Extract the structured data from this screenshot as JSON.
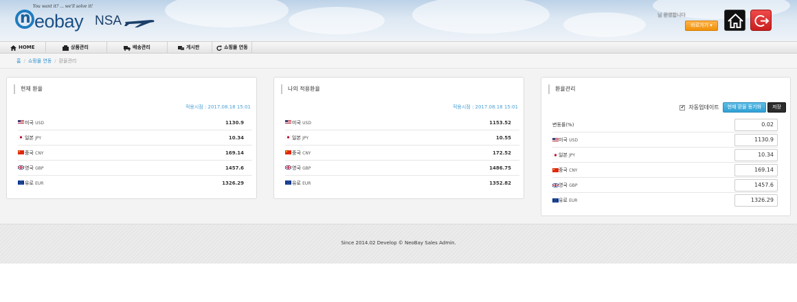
{
  "header": {
    "logo_tagline": "You want it? ... we'll solve it!",
    "logo_name": "eobay",
    "logo_suffix": "NSA",
    "user_info": "님 환영합니다",
    "dropdown_label": "바로가기 ▾"
  },
  "nav": {
    "items": [
      {
        "label": "HOME",
        "icon": "home-icon"
      },
      {
        "label": "상품관리",
        "icon": "box-icon"
      },
      {
        "label": "배송관리",
        "icon": "truck-icon"
      },
      {
        "label": "게시판",
        "icon": "board-icon"
      },
      {
        "label": "쇼핑몰 연동",
        "icon": "refresh-icon"
      }
    ]
  },
  "breadcrumb": {
    "items": [
      "홈",
      "쇼핑몰 연동",
      "환율관리"
    ]
  },
  "panels": {
    "current": {
      "title": "현재 환율",
      "date": "적용시점 : 2017.08.18 15:01",
      "rows": [
        {
          "flag": "us-flag-icon",
          "label": "미국",
          "currency": "USD",
          "value": "1130.9"
        },
        {
          "flag": "jp-flag-icon",
          "label": "일본",
          "currency": "JPY",
          "value": "10.34"
        },
        {
          "flag": "cn-flag-icon",
          "label": "중국",
          "currency": "CNY",
          "value": "169.14"
        },
        {
          "flag": "gb-flag-icon",
          "label": "영국",
          "currency": "GBP",
          "value": "1457.6"
        },
        {
          "flag": "eu-flag-icon",
          "label": "유로",
          "currency": "EUR",
          "value": "1326.29"
        }
      ]
    },
    "applied": {
      "title": "나의 적용환율",
      "date": "적용시점 : 2017.08.18 15:01",
      "rows": [
        {
          "flag": "us-flag-icon",
          "label": "미국",
          "currency": "USD",
          "value": "1153.52"
        },
        {
          "flag": "jp-flag-icon",
          "label": "일본",
          "currency": "JPY",
          "value": "10.55"
        },
        {
          "flag": "cn-flag-icon",
          "label": "중국",
          "currency": "CNY",
          "value": "172.52"
        },
        {
          "flag": "gb-flag-icon",
          "label": "영국",
          "currency": "GBP",
          "value": "1486.75"
        },
        {
          "flag": "eu-flag-icon",
          "label": "유로",
          "currency": "EUR",
          "value": "1352.82"
        }
      ]
    },
    "manage": {
      "title": "환율관리",
      "auto_update_label": "자동업데이트",
      "auto_update_checked": "✔",
      "sync_label": "현재 환율 동기화",
      "save_label": "저장",
      "rows": [
        {
          "label": "변동률(%)",
          "currency": "",
          "value": "0.02"
        },
        {
          "flag": "us-flag-icon",
          "label": "미국",
          "currency": "USD",
          "value": "1130.9"
        },
        {
          "flag": "jp-flag-icon",
          "label": "일본",
          "currency": "JPY",
          "value": "10.34"
        },
        {
          "flag": "cn-flag-icon",
          "label": "중국",
          "currency": "CNY",
          "value": "169.14"
        },
        {
          "flag": "gb-flag-icon",
          "label": "영국",
          "currency": "GBP",
          "value": "1457.6"
        },
        {
          "flag": "eu-flag-icon",
          "label": "유로",
          "currency": "EUR",
          "value": "1326.29"
        }
      ]
    }
  },
  "footer": {
    "text": "Since 2014.02 Develop © NeoBay Sales Admin."
  }
}
